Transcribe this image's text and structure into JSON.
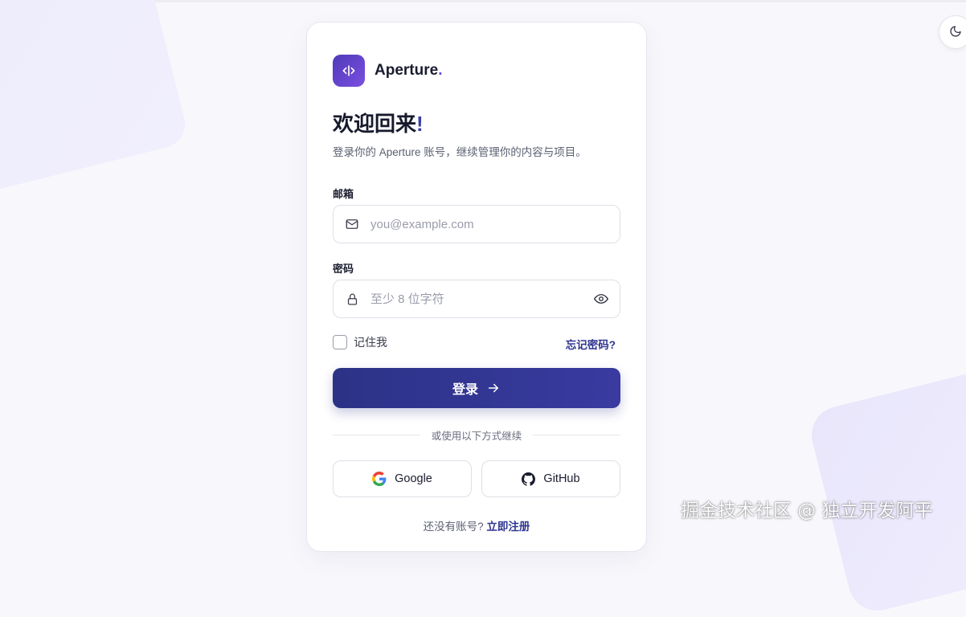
{
  "theme": {
    "accent": "#2e3590",
    "brand_gradient_start": "#4f3ab8",
    "brand_gradient_end": "#7b4fe0",
    "toggle_icon": "moon-icon"
  },
  "brand": {
    "name": "Aperture",
    "dot": ".",
    "logo_icon": "code-bracket-icon"
  },
  "header": {
    "title": "欢迎回来",
    "title_punct": "!",
    "subtitle": "登录你的 Aperture 账号，继续管理你的内容与项目。"
  },
  "form": {
    "email": {
      "label": "邮箱",
      "placeholder": "you@example.com",
      "value": "",
      "icon": "mail-icon"
    },
    "password": {
      "label": "密码",
      "placeholder": "至少 8 位字符",
      "value": "",
      "icon": "lock-icon",
      "toggle_icon": "eye-icon"
    },
    "remember_label": "记住我",
    "remember_checked": false,
    "forgot_label": "忘记密码?",
    "submit_label": "登录"
  },
  "divider_text": "或使用以下方式继续",
  "social": {
    "google_label": "Google",
    "github_label": "GitHub"
  },
  "signup": {
    "prompt": "还没有账号?",
    "link": "立即注册"
  },
  "watermark": "掘金技术社区 @ 独立开发阿平"
}
